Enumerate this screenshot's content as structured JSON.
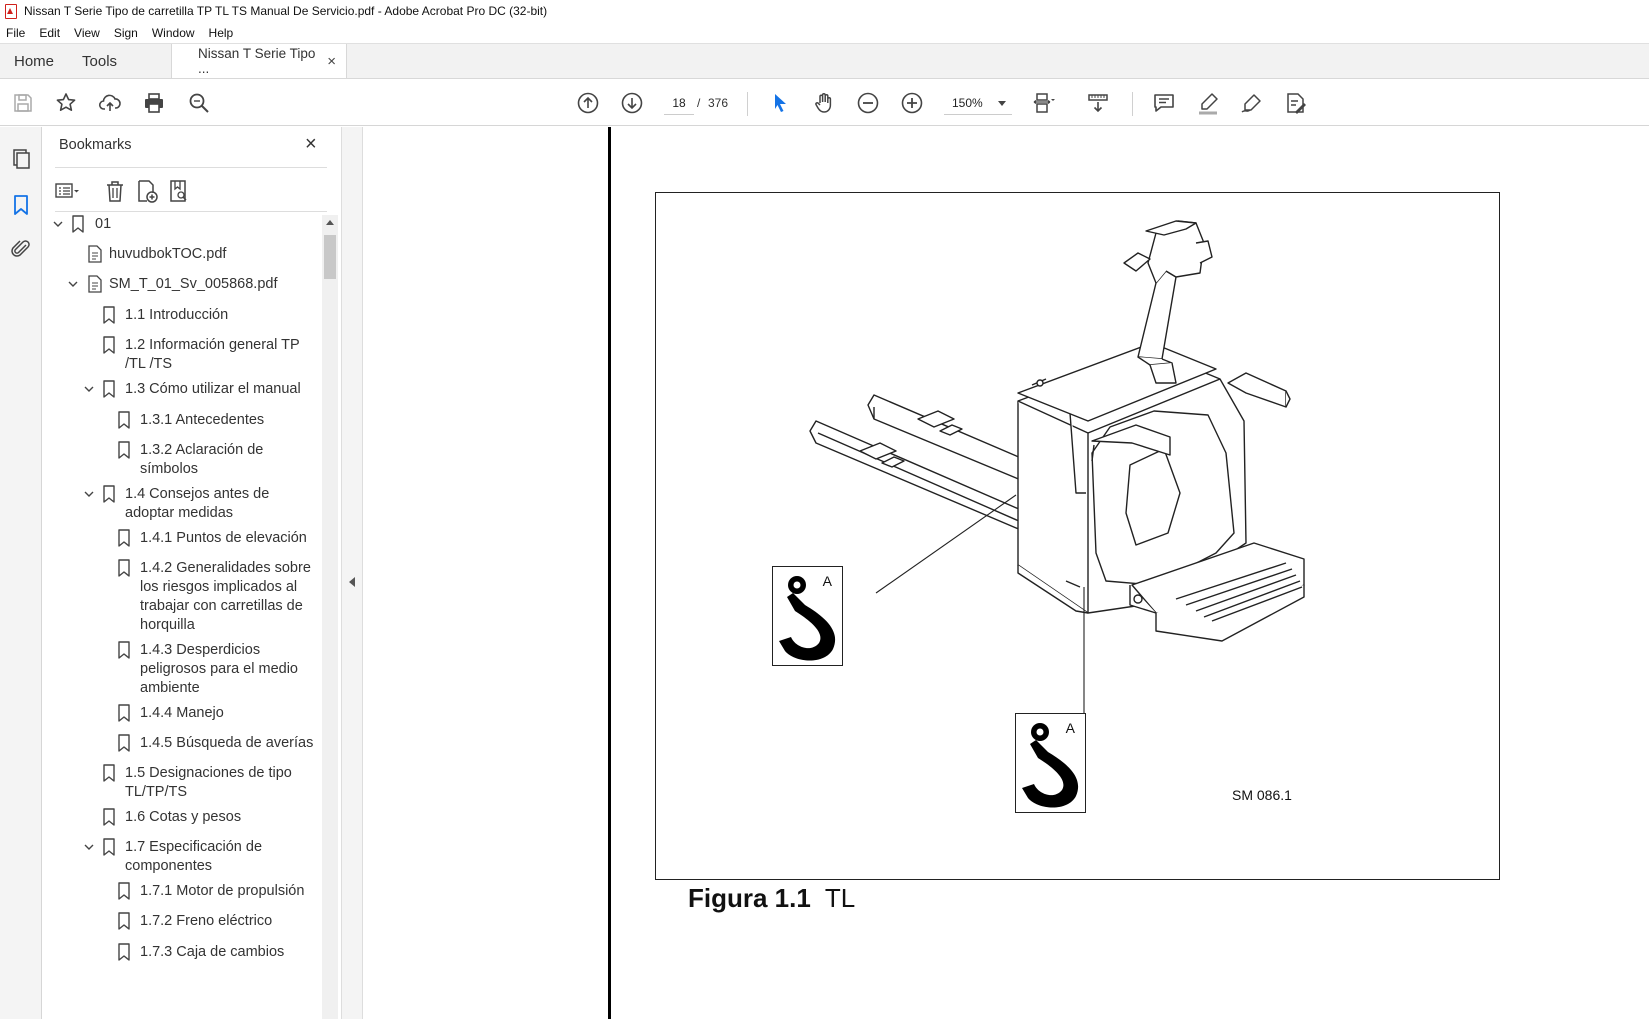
{
  "window": {
    "title": "Nissan T Serie Tipo de carretilla TP TL TS Manual De Servicio.pdf - Adobe Acrobat Pro DC (32-bit)"
  },
  "menu": [
    "File",
    "Edit",
    "View",
    "Sign",
    "Window",
    "Help"
  ],
  "tabs": {
    "home": "Home",
    "tools": "Tools",
    "doc": "Nissan T Serie Tipo ...",
    "doc_close": "×"
  },
  "toolbar": {
    "page_current": "18",
    "page_sep": "/",
    "page_total": "376",
    "zoom": "150%"
  },
  "bookmarks": {
    "title": "Bookmarks",
    "close": "×",
    "items": [
      {
        "label": "01"
      },
      {
        "label": "huvudbokTOC.pdf"
      },
      {
        "label": "SM_T_01_Sv_005868.pdf"
      },
      {
        "label": "1.1 Introducción"
      },
      {
        "label": "1.2 Información general TP /TL /TS"
      },
      {
        "label": "1.3 Cómo utilizar el manual"
      },
      {
        "label": "1.3.1 Antecedentes"
      },
      {
        "label": "1.3.2 Aclaración de símbolos"
      },
      {
        "label": "1.4 Consejos antes de adoptar medidas"
      },
      {
        "label": "1.4.1 Puntos de elevación"
      },
      {
        "label": "1.4.2 Generalidades sobre los riesgos implicados al trabajar con carretillas de horquilla"
      },
      {
        "label": "1.4.3 Desperdicios peligrosos para el medio ambiente"
      },
      {
        "label": "1.4.4 Manejo"
      },
      {
        "label": "1.4.5 Búsqueda de averías"
      },
      {
        "label": "1.5 Designaciones de tipo TL/TP/TS"
      },
      {
        "label": "1.6 Cotas y pesos"
      },
      {
        "label": "1.7 Especificación de componentes"
      },
      {
        "label": "1.7.1 Motor de propulsión"
      },
      {
        "label": "1.7.2 Freno eléctrico"
      },
      {
        "label": "1.7.3 Caja de cambios"
      }
    ]
  },
  "document": {
    "hook_label": "A",
    "drawing_code": "SM 086.1",
    "caption_bold": "Figura 1.1",
    "caption_text": "TL"
  }
}
